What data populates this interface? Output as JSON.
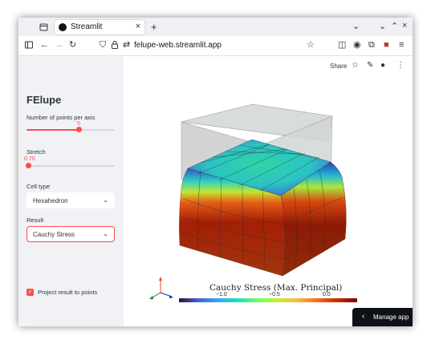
{
  "browser": {
    "tab_title": "Streamlit",
    "new_tab_icon": "+",
    "url": "felupe-web.streamlit.app"
  },
  "app": {
    "title": "FElupe",
    "points_per_axis": {
      "label": "Number of points per axis",
      "value": "5",
      "fraction": 0.55
    },
    "stretch": {
      "label": "Stretch",
      "value": "0.70",
      "fraction": 0.0
    },
    "cell_type": {
      "label": "Cell type",
      "value": "Hexahedron"
    },
    "result": {
      "label": "Result",
      "value": "Cauchy Stress"
    },
    "project": {
      "label": "Project result to points",
      "checked": true
    },
    "toolbar": {
      "share_label": "Share"
    },
    "manage_label": "Manage app"
  },
  "plot": {
    "colorbar_title": "Cauchy Stress (Max. Principal)",
    "ticks": [
      "−1.0",
      "−0.5",
      "0.0"
    ],
    "colors": {
      "low": "#30123b",
      "high": "#7a0403",
      "accent": "#ff4b4b"
    }
  }
}
